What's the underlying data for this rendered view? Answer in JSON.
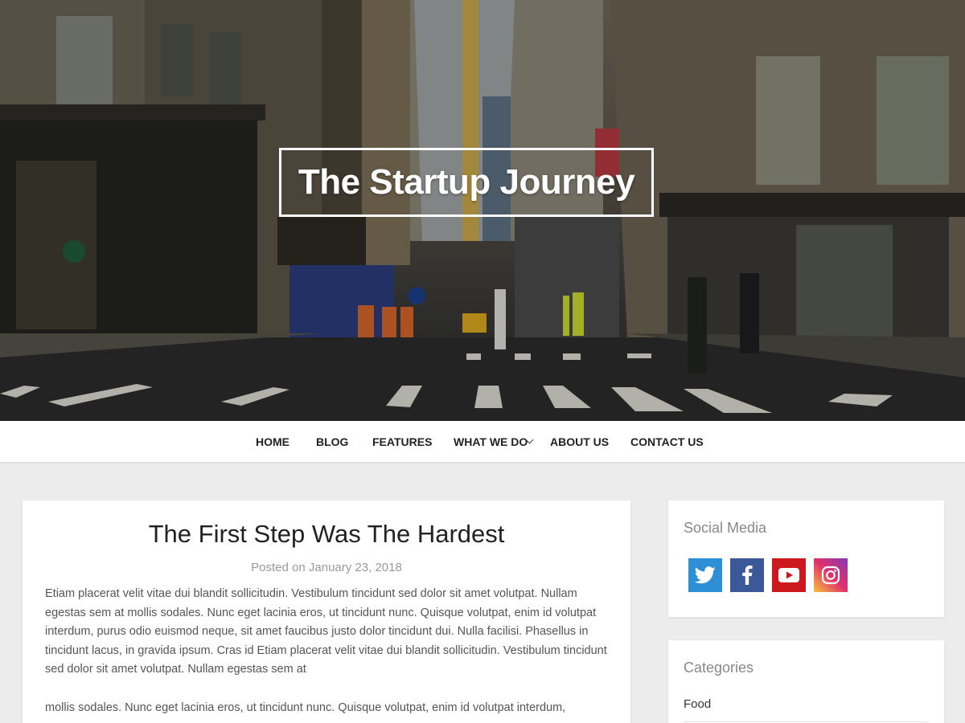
{
  "site": {
    "title": "The Startup Journey"
  },
  "nav": {
    "items": [
      {
        "label": "HOME"
      },
      {
        "label": "BLOG"
      },
      {
        "label": "FEATURES"
      },
      {
        "label": "WHAT WE DO",
        "has_submenu": true
      },
      {
        "label": "ABOUT US"
      },
      {
        "label": "CONTACT US"
      }
    ]
  },
  "post": {
    "title": "The First Step Was The Hardest",
    "posted_on_prefix": "Posted on",
    "date": "January 23, 2018",
    "paragraphs": [
      "Etiam placerat velit vitae dui blandit sollicitudin. Vestibulum tincidunt sed dolor sit amet volutpat. Nullam egestas sem at mollis sodales. Nunc eget lacinia eros, ut tincidunt nunc. Quisque volutpat, enim id volutpat interdum, purus odio euismod neque, sit amet faucibus justo dolor tincidunt dui. Nulla facilisi. Phasellus in tincidunt lacus, in gravida ipsum. Cras id Etiam placerat velit vitae dui blandit sollicitudin. Vestibulum tincidunt sed dolor sit amet volutpat. Nullam egestas sem at",
      "mollis sodales. Nunc eget lacinia eros, ut tincidunt nunc. Quisque volutpat, enim id volutpat interdum,"
    ]
  },
  "sidebar": {
    "social": {
      "heading": "Social Media",
      "icons": [
        {
          "name": "twitter-icon",
          "color": "#2d8fd5"
        },
        {
          "name": "facebook-icon",
          "color": "#3b5998"
        },
        {
          "name": "youtube-icon",
          "color": "#cc181e"
        },
        {
          "name": "instagram-icon",
          "color": "#c13584"
        }
      ]
    },
    "categories": {
      "heading": "Categories",
      "items": [
        "Food"
      ]
    }
  },
  "colors": {
    "page_bg": "#ececec",
    "card_bg": "#ffffff",
    "heading_gray": "#888888",
    "body_text": "#555555"
  }
}
